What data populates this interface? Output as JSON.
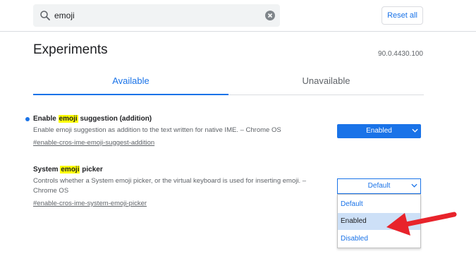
{
  "search": {
    "value": "emoji"
  },
  "header": {
    "reset_label": "Reset all"
  },
  "page": {
    "title": "Experiments",
    "version": "90.0.4430.100"
  },
  "tabs": [
    {
      "label": "Available"
    },
    {
      "label": "Unavailable"
    }
  ],
  "experiments": [
    {
      "title_before": "Enable ",
      "title_highlight": "emoji",
      "title_after": " suggestion (addition)",
      "description": "Enable emoji suggestion as addition to the text written for native IME. – Chrome OS",
      "link": "#enable-cros-ime-emoji-suggest-addition",
      "selected": "Enabled"
    },
    {
      "title_before": "System ",
      "title_highlight": "emoji",
      "title_after": " picker",
      "description": "Controls whether a System emoji picker, or the virtual keyboard is used for inserting emoji. – Chrome OS",
      "link": "#enable-cros-ime-system-emoji-picker",
      "selected": "Default",
      "options": [
        "Default",
        "Enabled",
        "Disabled"
      ]
    }
  ],
  "colors": {
    "accent": "#1a73e8",
    "highlight": "#ffff00",
    "arrow": "#e8232b"
  }
}
